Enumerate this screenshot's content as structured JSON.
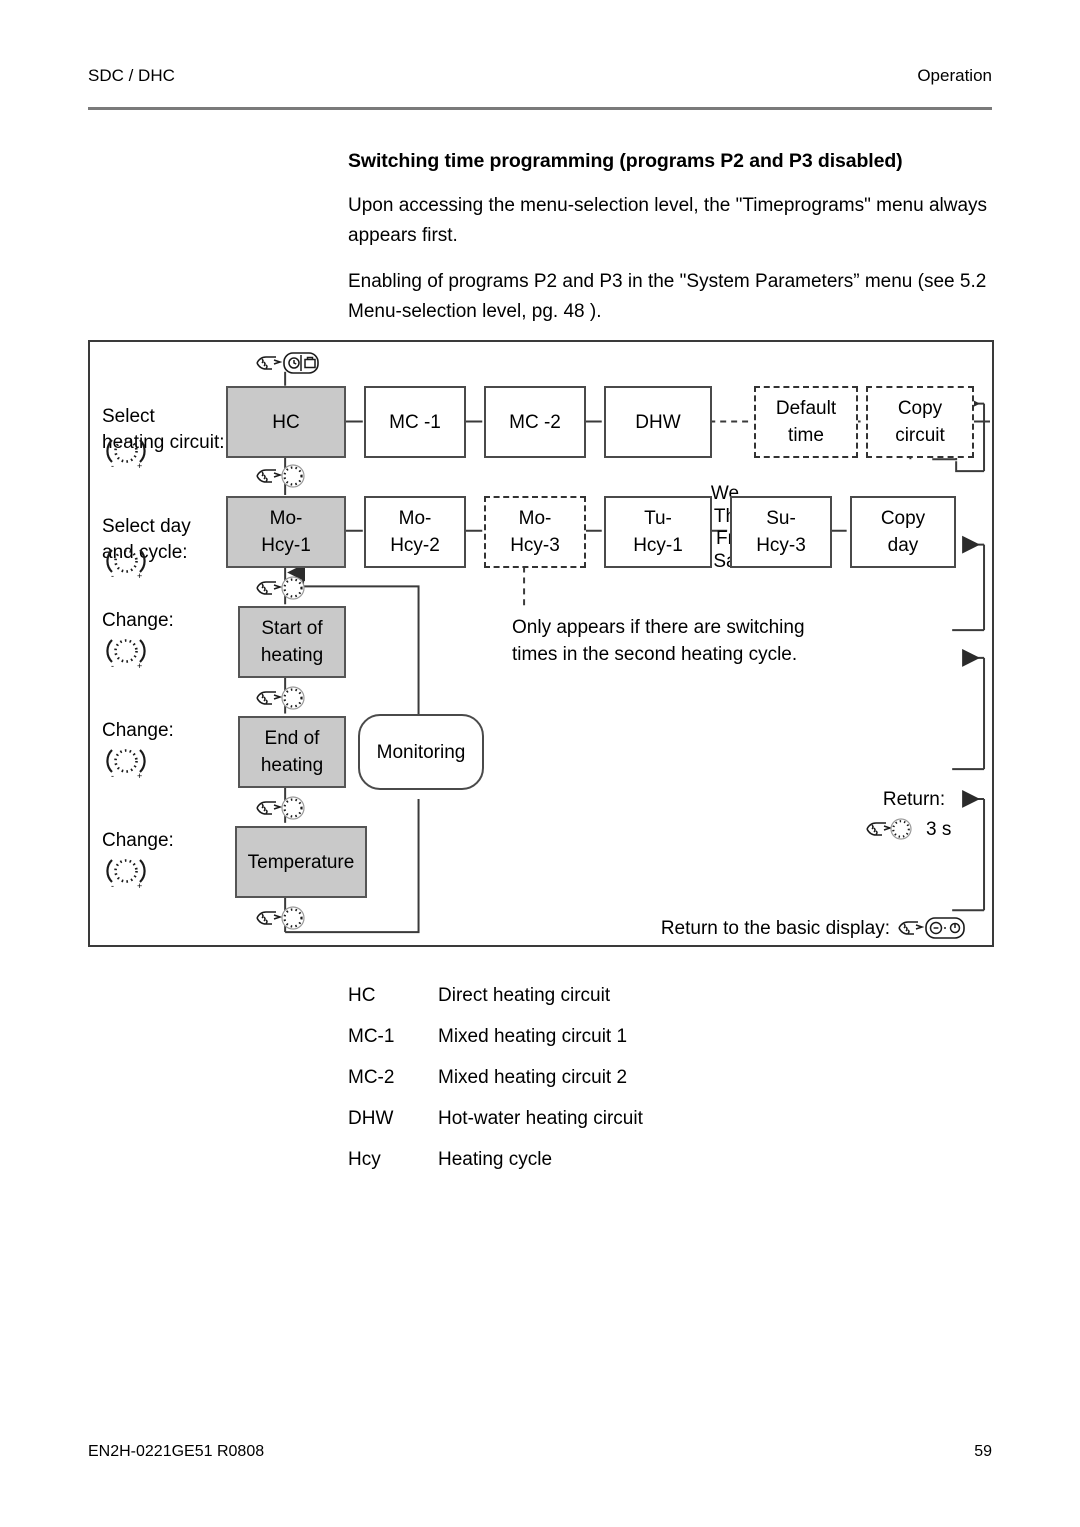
{
  "header": {
    "left": "SDC / DHC",
    "right": "Operation"
  },
  "intro": {
    "title": "Switching time programming (programs P2 and P3 disabled)",
    "paragraph1": "Upon accessing the menu-selection level, the \"Timeprograms\" menu always appears first.",
    "paragraph2": "Enabling of programs P2 and P3 in the \"System Parameters” menu (see 5.2 Menu-selection level, pg. 48 )."
  },
  "diagram": {
    "row_labels": {
      "select_circuit": "Select\nheating circuit:",
      "select_circuit_line1": "Select",
      "select_circuit_line2": "heating circuit:",
      "select_day_line1": "Select day",
      "select_day_line2": "and cycle:",
      "change1": "Change:",
      "change2": "Change:",
      "change3": "Change:"
    },
    "row1": {
      "nodes": [
        {
          "label": "HC",
          "style": "shaded"
        },
        {
          "label": "MC -1",
          "style": "solid"
        },
        {
          "label": "MC -2",
          "style": "solid"
        },
        {
          "label": "DHW",
          "style": "solid"
        },
        {
          "label": "Default\ntime",
          "line1": "Default",
          "line2": "time",
          "style": "dashed"
        },
        {
          "label": "Copy\ncircuit",
          "line1": "Copy",
          "line2": "circuit",
          "style": "dashed"
        }
      ]
    },
    "row2": {
      "nodes": [
        {
          "line1": "Mo-",
          "line2": "Hcy-1",
          "style": "shaded"
        },
        {
          "line1": "Mo-",
          "line2": "Hcy-2",
          "style": "solid"
        },
        {
          "line1": "Mo-",
          "line2": "Hcy-3",
          "style": "dashed"
        },
        {
          "line1": "Tu-",
          "line2": "Hcy-1",
          "style": "solid"
        },
        {
          "line1": "Su-",
          "line2": "Hcy-3",
          "style": "solid"
        },
        {
          "line1": "Copy",
          "line2": "day",
          "style": "solid"
        }
      ],
      "day_stack": [
        "We",
        "Th",
        "Fr",
        "Sa"
      ]
    },
    "column_nodes": [
      {
        "line1": "Start of",
        "line2": "heating",
        "style": "shaded"
      },
      {
        "line1": "End of",
        "line2": "heating",
        "style": "shaded"
      },
      {
        "line1": "Temperature",
        "line2": "",
        "style": "shaded"
      }
    ],
    "monitoring": {
      "label": "Monitoring"
    },
    "notes": {
      "only_appears_line1": "Only appears if there are switching",
      "only_appears_line2": "times in the second heating cycle.",
      "return_label": "Return:",
      "return_seconds": "3 s",
      "basic_display": "Return to the basic display:"
    },
    "icons": {
      "press_timeprog": "hand-press-timeprogram-button-icon",
      "press_knob": "hand-press-knob-icon",
      "rotary_knob": "rotary-knob-icon",
      "press_standby": "hand-press-standby-button-icon"
    }
  },
  "legend": {
    "rows": [
      {
        "abbr": "HC",
        "desc": "Direct heating circuit",
        "bold": false
      },
      {
        "abbr": "MC-1",
        "desc": "Mixed heating circuit 1",
        "bold": true
      },
      {
        "abbr": "MC-2",
        "desc": "Mixed heating circuit 2",
        "bold": true
      },
      {
        "abbr": "DHW",
        "desc": "Hot-water heating circuit",
        "bold": true
      },
      {
        "abbr": "Hcy",
        "desc": "Heating cycle",
        "bold": false
      }
    ]
  },
  "footer": {
    "left": "EN2H-0221GE51 R0808",
    "right": "59"
  },
  "colors": {
    "shaded_fill": "#c9c9c9",
    "line": "#4a4a4a",
    "rule": "#7a7a7a"
  }
}
